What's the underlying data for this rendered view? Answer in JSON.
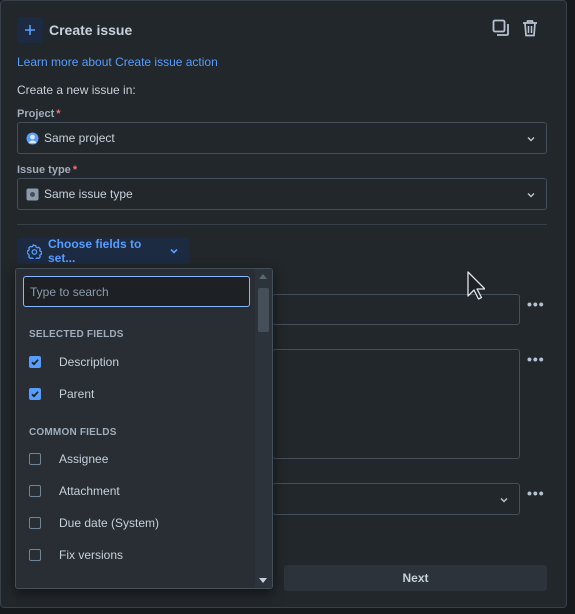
{
  "header": {
    "title": "Create issue",
    "icons": [
      "plus-icon",
      "copy-icon",
      "trash-icon"
    ]
  },
  "learn_link": "Learn more about Create issue action",
  "create_in": "Create a new issue in:",
  "project": {
    "label": "Project",
    "required": "*",
    "value": "Same project"
  },
  "issue_type": {
    "label": "Issue type",
    "required": "*",
    "value": "Same issue type"
  },
  "choose_fields": {
    "label": "Choose fields to set..."
  },
  "dropdown": {
    "search_placeholder": "Type to search",
    "selected_label": "SELECTED FIELDS",
    "selected": [
      "Description",
      "Parent"
    ],
    "common_label": "COMMON FIELDS",
    "common": [
      "Assignee",
      "Attachment",
      "Due date (System)",
      "Fix versions"
    ]
  },
  "next_label": "Next",
  "colors": {
    "accent": "#579dff",
    "required": "#f87168",
    "panel": "#22272b",
    "background": "#161a1d"
  }
}
